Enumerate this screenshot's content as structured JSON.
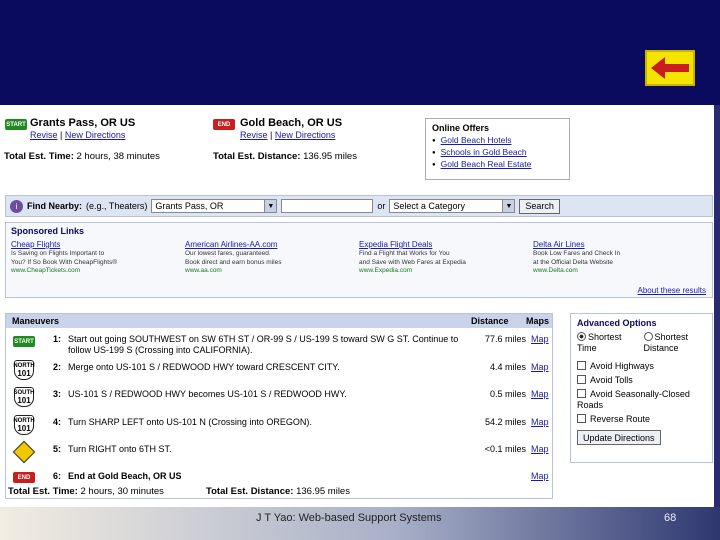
{
  "route": {
    "start_flag": "START",
    "end_flag": "END",
    "start_city": "Grants Pass, OR US",
    "end_city": "Gold Beach, OR US",
    "revise": "Revise",
    "separator": "|",
    "new_directions": "New Directions",
    "total_time_label": "Total Est. Time:",
    "total_time_value": "2 hours, 38 minutes",
    "total_distance_label": "Total Est. Distance:",
    "total_distance_value": "136.95 miles"
  },
  "offers": {
    "title": "Online Offers",
    "items": [
      "Gold Beach Hotels",
      "Schools in Gold Beach",
      "Gold Beach Real Estate"
    ]
  },
  "find": {
    "label": "Find Nearby:",
    "hint": "(e.g., Theaters)",
    "location": "Grants Pass, OR",
    "or": "or",
    "category": "Select a Category",
    "search": "Search"
  },
  "sponsored": {
    "title": "Sponsored Links",
    "ads": [
      {
        "title": "Cheap Flights",
        "l1": "Is Saving on Flights Important to",
        "l2": "You? If So Book With CheapFlights®",
        "url": "www.CheapTickets.com"
      },
      {
        "title": "American Airlines-AA.com",
        "l1": "Our lowest fares, guaranteed.",
        "l2": "Book direct and earn bonus miles",
        "url": "www.aa.com"
      },
      {
        "title": "Expedia Flight Deals",
        "l1": "Find a Flight that Works for You",
        "l2": "and Save with Web Fares at Expedia",
        "url": "www.Expedia.com"
      },
      {
        "title": "Delta Air Lines",
        "l1": "Book Low Fares and Check In",
        "l2": "at the Official Delta Website",
        "url": "www.Delta.com"
      }
    ],
    "about": "About these results"
  },
  "maneuvers": {
    "head": {
      "maneuvers": "Maneuvers",
      "distance": "Distance",
      "maps": "Maps"
    },
    "rows": [
      {
        "num": "1:",
        "desc": "Start out going SOUTHWEST on SW 6TH ST / OR-99 S / US-199 S toward SW G ST. Continue to follow US-199 S (Crossing into CALIFORNIA).",
        "dist": "77.6 miles",
        "map": "Map",
        "icon": "START",
        "shield_top": "",
        "shield_num": ""
      },
      {
        "num": "2:",
        "desc": "Merge onto US-101 S / REDWOOD HWY toward CRESCENT CITY.",
        "dist": "4.4 miles",
        "map": "Map",
        "icon": "",
        "shield_top": "NORTH",
        "shield_num": "101"
      },
      {
        "num": "3:",
        "desc": "US-101 S / REDWOOD HWY becomes US-101 S / REDWOOD HWY.",
        "dist": "0.5 miles",
        "map": "Map",
        "icon": "",
        "shield_top": "SOUTH",
        "shield_num": "101"
      },
      {
        "num": "4:",
        "desc": "Turn SHARP LEFT onto US-101 N (Crossing into OREGON).",
        "dist": "54.2 miles",
        "map": "Map",
        "icon": "",
        "shield_top": "NORTH",
        "shield_num": "101"
      },
      {
        "num": "5:",
        "desc": "Turn RIGHT onto 6TH ST.",
        "dist": "<0.1 miles",
        "map": "Map",
        "icon": "",
        "shield_top": "",
        "shield_num": ""
      },
      {
        "num": "6:",
        "desc": "End at Gold Beach, OR US",
        "dist": "",
        "map": "Map",
        "icon": "END",
        "shield_top": "",
        "shield_num": ""
      }
    ],
    "total_time_label": "Total Est. Time:",
    "total_time_value": "2 hours, 30 minutes",
    "total_distance_label": "Total Est. Distance:",
    "total_distance_value": "136.95 miles"
  },
  "advanced": {
    "title": "Advanced Options",
    "shortest_time": "Shortest Time",
    "shortest_distance": "Shortest Distance",
    "avoid_highways": "Avoid Highways",
    "avoid_tolls": "Avoid Tolls",
    "avoid_seasonal": "Avoid Seasonally-Closed Roads",
    "reverse_route": "Reverse Route",
    "update": "Update Directions"
  },
  "footer": {
    "text": "J T Yao: Web-based Support Systems",
    "page": "68"
  },
  "colors": {
    "band": "#0a0a5e",
    "back_button": "#f5e300",
    "arrow": "#c81e1e"
  }
}
